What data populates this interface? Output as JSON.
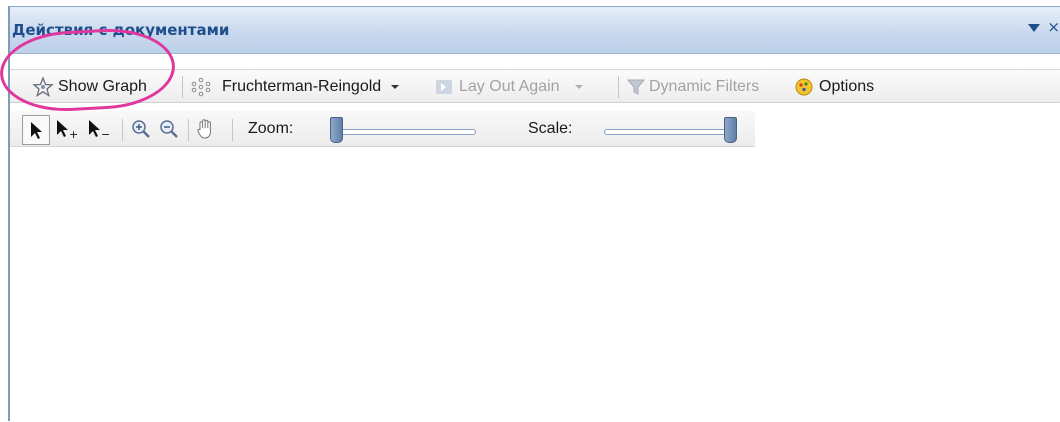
{
  "panel": {
    "title": "Действия с документами"
  },
  "toolbar": {
    "show_graph": "Show Graph",
    "layout_algorithm": "Fruchterman-Reingold",
    "lay_out_again": "Lay Out Again",
    "dynamic_filters": "Dynamic Filters",
    "options": "Options"
  },
  "navbar": {
    "zoom_label": "Zoom:",
    "scale_label": "Scale:",
    "zoom_level": 0.0,
    "scale_level": 1.0
  },
  "icons": [
    "pin-icon",
    "close-icon",
    "graph-star-icon",
    "layout-snowflake-icon",
    "dropdown-arrow-icon",
    "layout-again-icon",
    "funnel-icon",
    "options-icon",
    "pointer-icon",
    "pointer-add-icon",
    "pointer-remove-icon",
    "zoom-in-icon",
    "zoom-out-icon",
    "pan-hand-icon"
  ],
  "colors": {
    "title": "#1f4e8c",
    "highlight": "#e0379e",
    "disabled": "#a3a3a3"
  }
}
